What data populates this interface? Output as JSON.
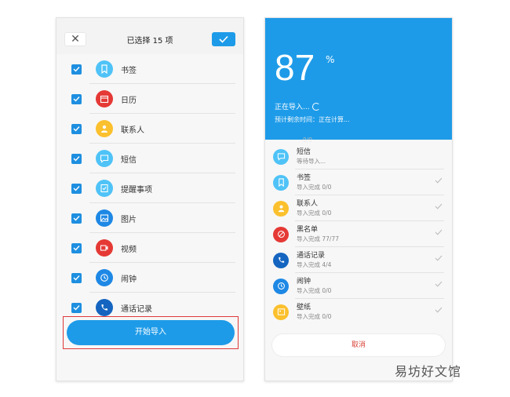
{
  "left_screen": {
    "title": "已选择 15 项",
    "close_icon": "close-icon",
    "confirm_icon": "check-icon",
    "items": [
      {
        "label": "书签",
        "icon": "bookmark-icon",
        "color": "#4fc3f7"
      },
      {
        "label": "日历",
        "icon": "calendar-icon",
        "color": "#e53935"
      },
      {
        "label": "联系人",
        "icon": "contact-icon",
        "color": "#fbc02d"
      },
      {
        "label": "短信",
        "icon": "message-icon",
        "color": "#4fc3f7"
      },
      {
        "label": "提醒事项",
        "icon": "reminder-icon",
        "color": "#4fc3f7"
      },
      {
        "label": "图片",
        "icon": "image-icon",
        "color": "#1e88e5"
      },
      {
        "label": "视频",
        "icon": "video-icon",
        "color": "#e53935"
      },
      {
        "label": "闹钟",
        "icon": "alarm-icon",
        "color": "#1e88e5"
      },
      {
        "label": "通话记录",
        "icon": "call-log-icon",
        "color": "#1565c0"
      }
    ],
    "start_button": "开始导入"
  },
  "right_screen": {
    "percent": "87",
    "percent_sign": "%",
    "importing_text": "正在导入...",
    "eta_text": "预计剩余时间：正在计算...",
    "partial_top_status": "0/0",
    "items": [
      {
        "name": "短信",
        "status": "等待导入...",
        "icon": "message-icon",
        "color": "#4fc3f7",
        "check": false
      },
      {
        "name": "书签",
        "status": "导入完成  0/0",
        "icon": "bookmark-icon",
        "color": "#4fc3f7",
        "check": true
      },
      {
        "name": "联系人",
        "status": "导入完成  0/0",
        "icon": "contact-icon",
        "color": "#fbc02d",
        "check": true
      },
      {
        "name": "黑名单",
        "status": "导入完成  77/77",
        "icon": "block-icon",
        "color": "#e53935",
        "check": true
      },
      {
        "name": "通话记录",
        "status": "导入完成  4/4",
        "icon": "call-log-icon",
        "color": "#1565c0",
        "check": true
      },
      {
        "name": "闹钟",
        "status": "导入完成  0/0",
        "icon": "alarm-icon",
        "color": "#1e88e5",
        "check": true
      },
      {
        "name": "壁纸",
        "status": "导入完成  0/0",
        "icon": "wallpaper-icon",
        "color": "#fbc02d",
        "check": true
      }
    ],
    "cancel_button": "取消"
  },
  "watermark": "易坊好文馆",
  "colors": {
    "accent": "#1e9be8",
    "cancel": "#d9443a",
    "highlight_frame": "#e0393a"
  }
}
